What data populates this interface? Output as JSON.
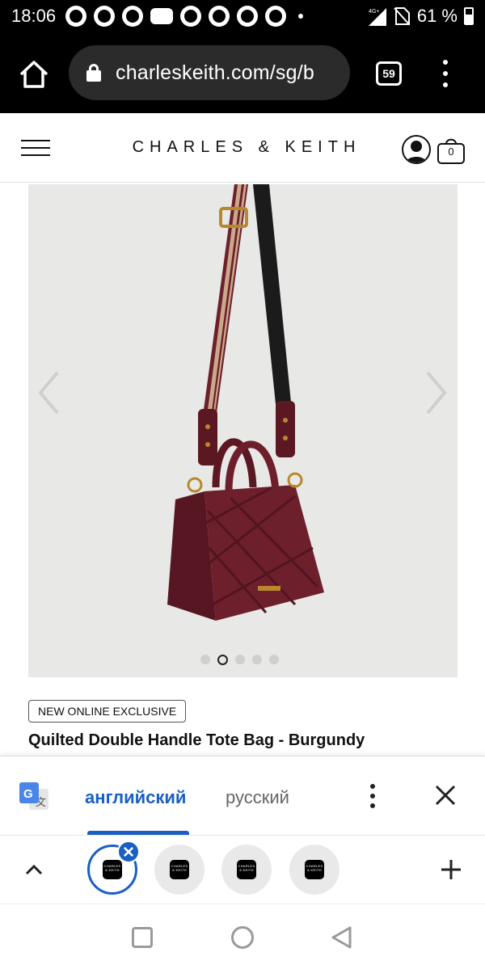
{
  "status_bar": {
    "time": "18:06",
    "network": "4G+",
    "battery": "61 %",
    "notification_icons": [
      "whatsapp-icon",
      "messages-icon",
      "app-icon",
      "youtube-icon",
      "instagram-icon",
      "threads-icon",
      "threads-icon",
      "instagram-icon"
    ]
  },
  "browser": {
    "url": "charleskeith.com/sg/b",
    "tab_count": "59"
  },
  "site": {
    "logo": "CHARLES & KEITH",
    "cart_count": "0"
  },
  "product": {
    "badge": "NEW ONLINE EXCLUSIVE",
    "title": "Quilted Double Handle Tote Bag - Burgundy",
    "image_count": 5,
    "active_image": 1
  },
  "translate_bar": {
    "source_language": "английский",
    "target_language": "русский"
  },
  "tabs": {
    "favicon_text": "CHARLES & KEITH",
    "count": 4
  },
  "colors": {
    "accent": "#1a5fc4",
    "bag": "#6e1f2c",
    "image_bg": "#e8e8e7"
  }
}
